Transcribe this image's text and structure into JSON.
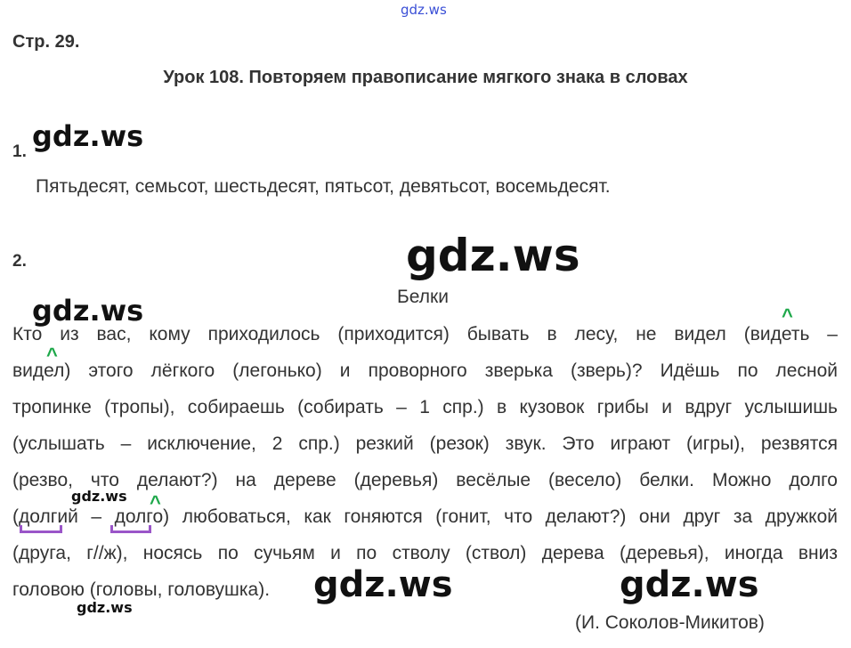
{
  "watermarks": {
    "top": "gdz.ws",
    "w1": "gdz.ws",
    "w2_large": "gdz.ws",
    "w3": "gdz.ws",
    "w4_small": "gdz.ws",
    "w5_small": "gdz.ws",
    "w6_large": "gdz.ws",
    "w7_large": "gdz.ws"
  },
  "header": {
    "page_ref": "Стр. 29.",
    "lesson_title": "Урок 108. Повторяем правописание мягкого знака в словах"
  },
  "exercise1": {
    "number": "1.",
    "text": "Пятьдесят, семьсот, шестьдесят, пятьсот, девятьсот, восемьдесят."
  },
  "exercise2": {
    "number": "2.",
    "title": "Белки",
    "lines": [
      "Кто из вас, кому приходилось (приходится) бывать в лесу, не видел (видеть –",
      "видел) этого лёгкого (легонько) и проворного зверька (зверь)? Идёшь по лесной",
      "тропинке (тропы), собираешь (собирать – 1 спр.) в кузовок грибы и вдруг услышишь",
      "(услышать – исключение, 2 спр.) резкий (резок) звук. Это играют (игры), резвятся",
      "(резво, что делают?) на дереве (деревья) весёлые (весело) белки. Можно долго",
      "(долгий – долго) любоваться, как гоняются (гонит, что делают?) они друг за дружкой",
      "(друга, г//ж), носясь по сучьям и по стволу (ствол) дерева (деревья), иногда вниз",
      "головою (головы, головушка)."
    ],
    "author": "(И. Соколов-Микитов)"
  }
}
